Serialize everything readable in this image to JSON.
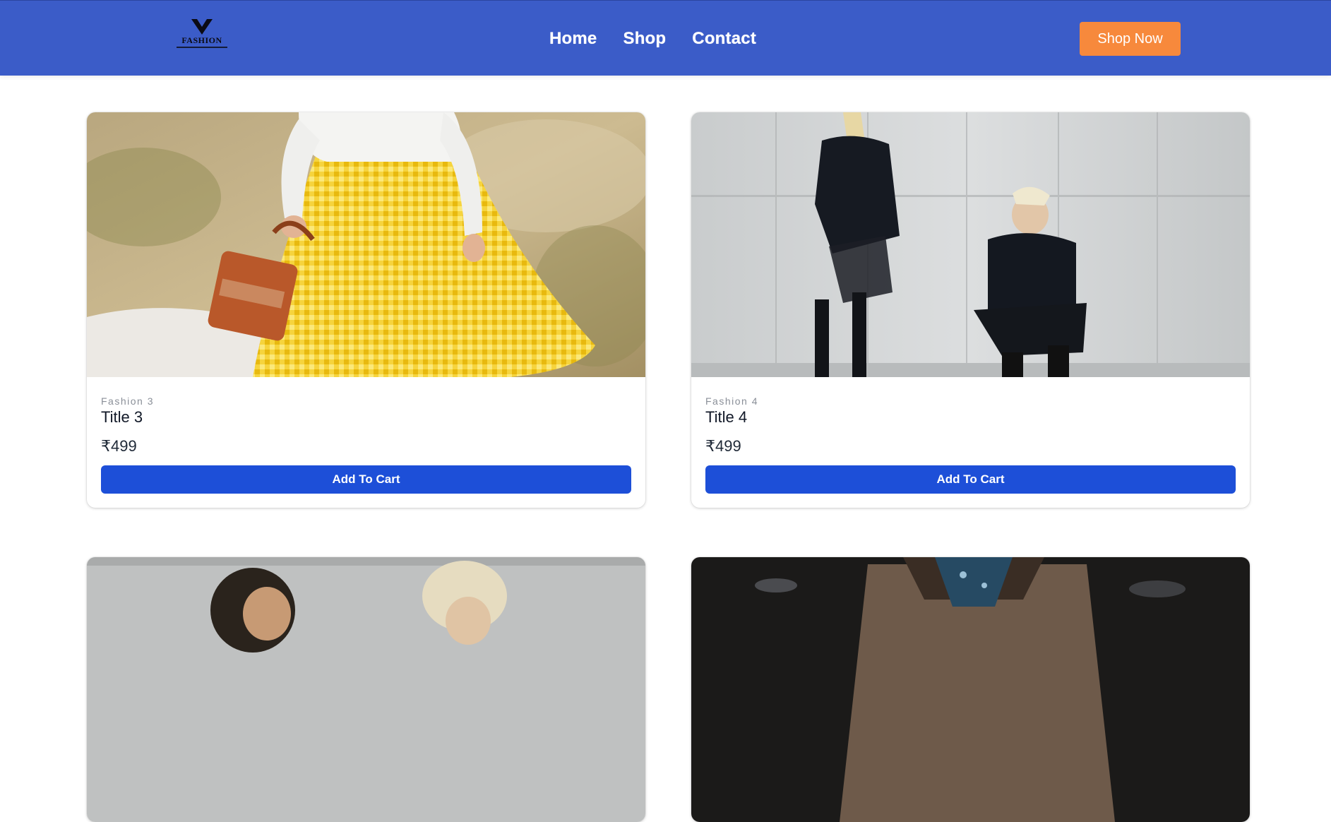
{
  "header": {
    "logo_text": "FASHION",
    "nav": [
      "Home",
      "Shop",
      "Contact"
    ],
    "cta": "Shop Now"
  },
  "products": [
    {
      "category": "Fashion 3",
      "title": "Title 3",
      "price": "₹499",
      "button": "Add To Cart"
    },
    {
      "category": "Fashion 4",
      "title": "Title 4",
      "price": "₹499",
      "button": "Add To Cart"
    }
  ],
  "colors": {
    "header_bg": "#3b5cc8",
    "cta_bg": "#f7893c",
    "button_bg": "#1d4fd8"
  }
}
